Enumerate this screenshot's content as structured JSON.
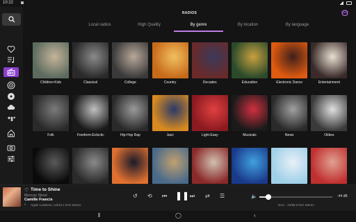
{
  "status_bar": {
    "time": "10:22"
  },
  "header": {
    "title": "RADIOS",
    "logo": "app-logo-icon"
  },
  "tabs": [
    {
      "label": "Local radios",
      "active": false
    },
    {
      "label": "High Quality",
      "active": false
    },
    {
      "label": "By genre",
      "active": true
    },
    {
      "label": "By location",
      "active": false
    },
    {
      "label": "By language",
      "active": false
    }
  ],
  "sidebar": {
    "items": [
      "search-icon",
      "heart-icon",
      "playlist-icon",
      "radio-icon",
      "podcast-icon",
      "vinyl-icon",
      "cloud-icon",
      "tidal-icon",
      "home-icon",
      "device-icon",
      "settings-sliders-icon"
    ],
    "active": "radio-icon"
  },
  "genres": [
    {
      "label": "Children-Kids",
      "colors": [
        "#5c6b5e",
        "#c4b49a"
      ]
    },
    {
      "label": "Classical",
      "colors": [
        "#2a2a2a",
        "#8a8a8a"
      ]
    },
    {
      "label": "College",
      "colors": [
        "#3a3a3a",
        "#b8a89a"
      ]
    },
    {
      "label": "Country",
      "colors": [
        "#c86a1a",
        "#f0c060"
      ]
    },
    {
      "label": "Decades",
      "colors": [
        "#6a2a2a",
        "#3a3a5a"
      ]
    },
    {
      "label": "Education",
      "colors": [
        "#2a4a2a",
        "#c8a040"
      ]
    },
    {
      "label": "Electronic Dance",
      "colors": [
        "#e05a10",
        "#40201a"
      ]
    },
    {
      "label": "Entertainment",
      "colors": [
        "#3a2a2a",
        "#e8e0d0"
      ]
    },
    {
      "label": "Folk",
      "colors": [
        "#2a2a2a",
        "#7a7a7a"
      ]
    },
    {
      "label": "Freeform-Eclectic",
      "colors": [
        "#1a1a1a",
        "#c0c0c0"
      ]
    },
    {
      "label": "Hip-Hop Rap",
      "colors": [
        "#2a2a2a",
        "#9a9a9a"
      ]
    },
    {
      "label": "Jazz",
      "colors": [
        "#d88a20",
        "#2a3a6a"
      ]
    },
    {
      "label": "Light-Easy",
      "colors": [
        "#8a1a20",
        "#e04040"
      ]
    },
    {
      "label": "Musicals",
      "colors": [
        "#1a1a1a",
        "#d03040"
      ]
    },
    {
      "label": "News",
      "colors": [
        "#2a2a2a",
        "#a0a0a0"
      ]
    },
    {
      "label": "Oldies",
      "colors": [
        "#3a3a3a",
        "#e0e0e0"
      ]
    },
    {
      "label": "",
      "colors": [
        "#0a0a0a",
        "#5a5a5a"
      ]
    },
    {
      "label": "",
      "colors": [
        "#2a2a2a",
        "#8a8a8a"
      ]
    },
    {
      "label": "",
      "colors": [
        "#e07030",
        "#1a1a2a"
      ]
    },
    {
      "label": "",
      "colors": [
        "#4a6a8a",
        "#c0a070"
      ]
    },
    {
      "label": "",
      "colors": [
        "#8a2a2a",
        "#d0c0b0"
      ]
    },
    {
      "label": "",
      "colors": [
        "#1a3a8a",
        "#40a0e0"
      ]
    },
    {
      "label": "",
      "colors": [
        "#a0d0e8",
        "#e8f0f8"
      ]
    },
    {
      "label": "",
      "colors": [
        "#c03030",
        "#e0a090"
      ]
    }
  ],
  "player": {
    "title": "Time to Shine",
    "album": "Mercury Street",
    "artist": "Camille Francis",
    "quality": "Apple Lossless | 16/44.1 kHz Stereo",
    "volume_db": "-44 dB",
    "volume_level": 0.12,
    "dac": "DAC : 24/96.0 kHz Stereo"
  },
  "colors": {
    "accent": "#c07ce8",
    "background": "#141414",
    "sidebar": "#1a1a1a"
  }
}
